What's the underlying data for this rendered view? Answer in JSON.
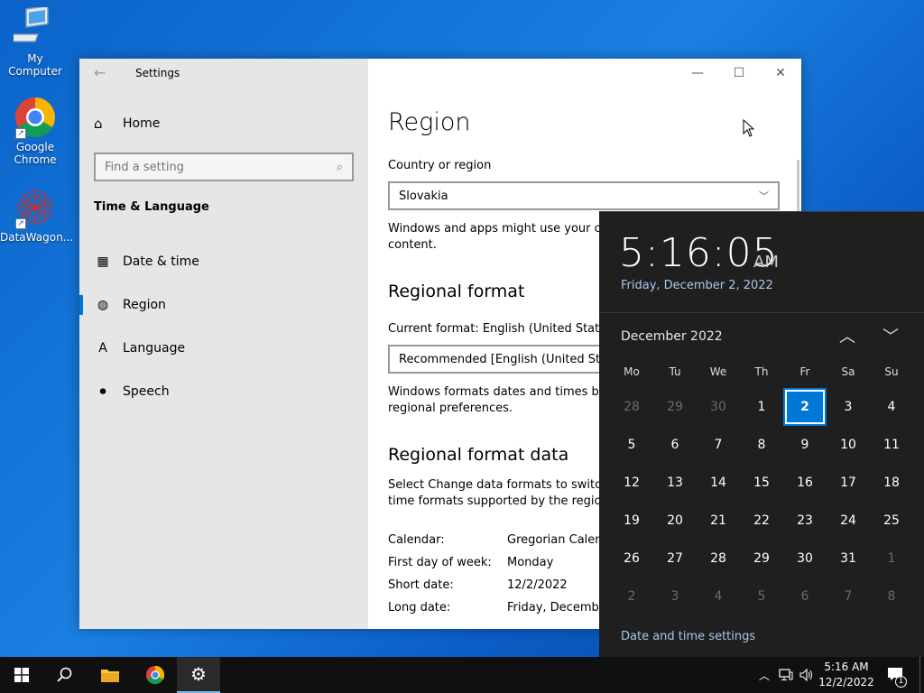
{
  "desktop": {
    "icons": [
      {
        "label": "My Computer",
        "icon": "computer-icon"
      },
      {
        "label": "Google Chrome",
        "icon": "chrome-icon"
      },
      {
        "label": "DataWagon...",
        "icon": "datawagon-icon"
      }
    ]
  },
  "window": {
    "title": "Settings",
    "sidebar": {
      "home_label": "Home",
      "search_placeholder": "Find a setting",
      "section_title": "Time & Language",
      "items": [
        {
          "label": "Date & time",
          "icon": "calendar-clock-icon"
        },
        {
          "label": "Region",
          "icon": "globe-icon",
          "active": true
        },
        {
          "label": "Language",
          "icon": "language-icon"
        },
        {
          "label": "Speech",
          "icon": "microphone-icon"
        }
      ]
    },
    "content": {
      "title": "Region",
      "country_label": "Country or region",
      "country_value": "Slovakia",
      "country_desc_line1": "Windows and apps might use your co",
      "country_desc_line2": "content.",
      "regional_format_heading": "Regional format",
      "current_format_label": "Current format: English (United States",
      "format_value": "Recommended [English (United Stat",
      "format_desc_line1": "Windows formats dates and times bas",
      "format_desc_line2": "regional preferences.",
      "format_data_heading": "Regional format data",
      "format_data_desc_line1": "Select Change data formats to switch",
      "format_data_desc_line2": "time formats supported by the region",
      "rows": [
        {
          "key": "Calendar:",
          "value": "Gregorian Calen"
        },
        {
          "key": "First day of week:",
          "value": "Monday"
        },
        {
          "key": "Short date:",
          "value": "12/2/2022"
        },
        {
          "key": "Long date:",
          "value": "Friday, Decembe"
        }
      ]
    }
  },
  "flyout": {
    "time": "5:16:05",
    "ampm": "AM",
    "date": "Friday, December 2, 2022",
    "month": "December 2022",
    "weekdays": [
      "Mo",
      "Tu",
      "We",
      "Th",
      "Fr",
      "Sa",
      "Su"
    ],
    "days": [
      {
        "d": "28",
        "dim": true
      },
      {
        "d": "29",
        "dim": true
      },
      {
        "d": "30",
        "dim": true
      },
      {
        "d": "1"
      },
      {
        "d": "2",
        "today": true
      },
      {
        "d": "3"
      },
      {
        "d": "4"
      },
      {
        "d": "5"
      },
      {
        "d": "6"
      },
      {
        "d": "7"
      },
      {
        "d": "8"
      },
      {
        "d": "9"
      },
      {
        "d": "10"
      },
      {
        "d": "11"
      },
      {
        "d": "12"
      },
      {
        "d": "13"
      },
      {
        "d": "14"
      },
      {
        "d": "15"
      },
      {
        "d": "16"
      },
      {
        "d": "17"
      },
      {
        "d": "18"
      },
      {
        "d": "19"
      },
      {
        "d": "20"
      },
      {
        "d": "21"
      },
      {
        "d": "22"
      },
      {
        "d": "23"
      },
      {
        "d": "24"
      },
      {
        "d": "25"
      },
      {
        "d": "26"
      },
      {
        "d": "27"
      },
      {
        "d": "28"
      },
      {
        "d": "29"
      },
      {
        "d": "30"
      },
      {
        "d": "31"
      },
      {
        "d": "1",
        "dim": true
      },
      {
        "d": "2",
        "dim": true
      },
      {
        "d": "3",
        "dim": true
      },
      {
        "d": "4",
        "dim": true
      },
      {
        "d": "5",
        "dim": true
      },
      {
        "d": "6",
        "dim": true
      },
      {
        "d": "7",
        "dim": true
      },
      {
        "d": "8",
        "dim": true
      }
    ],
    "settings_link": "Date and time settings"
  },
  "taskbar": {
    "time": "5:16 AM",
    "date": "12/2/2022",
    "notification_count": "1",
    "apps": [
      "start-icon",
      "search-icon",
      "file-explorer-icon",
      "chrome-icon",
      "settings-gear-icon"
    ]
  },
  "colors": {
    "accent": "#0078d7",
    "flyout_bg": "#1f1f1f",
    "link": "#a7c9ee"
  }
}
